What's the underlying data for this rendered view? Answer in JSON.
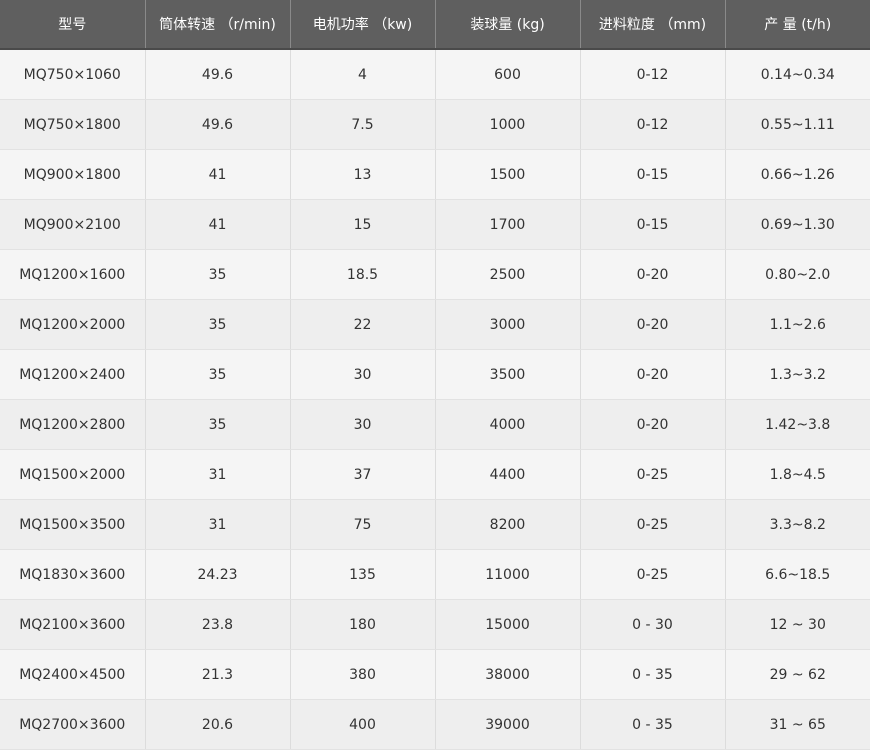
{
  "table": {
    "headers": [
      "型号",
      "筒体转速 （r/min)",
      "电机功率 （kw)",
      "装球量 (kg)",
      "进料粒度 （mm)",
      "产 量 (t/h)"
    ],
    "rows": [
      [
        "MQ750×1060",
        "49.6",
        "4",
        "600",
        "0-12",
        "0.14~0.34"
      ],
      [
        "MQ750×1800",
        "49.6",
        "7.5",
        "1000",
        "0-12",
        "0.55~1.11"
      ],
      [
        "MQ900×1800",
        "41",
        "13",
        "1500",
        "0-15",
        "0.66~1.26"
      ],
      [
        "MQ900×2100",
        "41",
        "15",
        "1700",
        "0-15",
        "0.69~1.30"
      ],
      [
        "MQ1200×1600",
        "35",
        "18.5",
        "2500",
        "0-20",
        "0.80~2.0"
      ],
      [
        "MQ1200×2000",
        "35",
        "22",
        "3000",
        "0-20",
        "1.1~2.6"
      ],
      [
        "MQ1200×2400",
        "35",
        "30",
        "3500",
        "0-20",
        "1.3~3.2"
      ],
      [
        "MQ1200×2800",
        "35",
        "30",
        "4000",
        "0-20",
        "1.42~3.8"
      ],
      [
        "MQ1500×2000",
        "31",
        "37",
        "4400",
        "0-25",
        "1.8~4.5"
      ],
      [
        "MQ1500×3500",
        "31",
        "75",
        "8200",
        "0-25",
        "3.3~8.2"
      ],
      [
        "MQ1830×3600",
        "24.23",
        "135",
        "11000",
        "0-25",
        "6.6~18.5"
      ],
      [
        "MQ2100×3600",
        "23.8",
        "180",
        "15000",
        "0 - 30",
        "12 ~ 30"
      ],
      [
        "MQ2400×4500",
        "21.3",
        "380",
        "38000",
        "0 - 35",
        "29 ~ 62"
      ],
      [
        "MQ2700×3600",
        "20.6",
        "400",
        "39000",
        "0 - 35",
        "31 ~ 65"
      ]
    ]
  },
  "colors": {
    "header_bg": "#5f5f5f",
    "header_text": "#ffffff",
    "row_odd_bg": "#f5f5f5",
    "row_even_bg": "#eeeeee",
    "cell_text": "#333333"
  }
}
